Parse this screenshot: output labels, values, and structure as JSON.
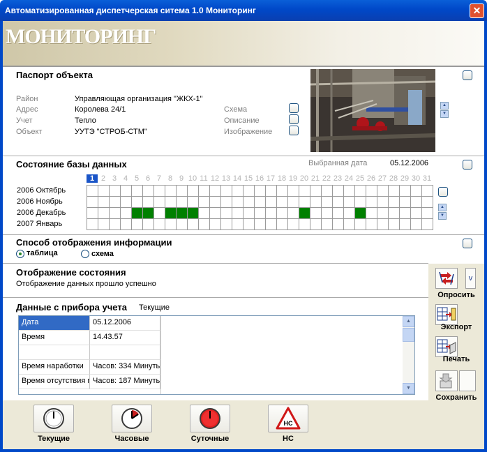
{
  "window": {
    "title": "Автоматизированная диспетчерская ситема 1.0 Мониторинг",
    "close_glyph": "✕"
  },
  "banner": {
    "text": "МОНИТОРИНГ"
  },
  "passport": {
    "title": "Паспорт объекта",
    "fields": [
      {
        "label": "Район",
        "value": "Управляющая организация \"ЖКХ-1\""
      },
      {
        "label": "Адрес",
        "value": "Королева 24/1"
      },
      {
        "label": "Учет",
        "value": "Тепло"
      },
      {
        "label": "Объект",
        "value": "УУТЭ \"СТРОБ-СТМ\""
      }
    ],
    "options": [
      {
        "label": "Схема",
        "checked": false
      },
      {
        "label": "Описание",
        "checked": false
      },
      {
        "label": "Изображение",
        "checked": false
      }
    ]
  },
  "database": {
    "title": "Состояние базы данных",
    "selected_date_label": "Выбранная дата",
    "selected_date": "05.12.2006",
    "selected_day": 1,
    "days": [
      "1",
      "2",
      "3",
      "4",
      "5",
      "6",
      "7",
      "8",
      "9",
      "10",
      "11",
      "12",
      "13",
      "14",
      "15",
      "16",
      "17",
      "18",
      "19",
      "20",
      "21",
      "22",
      "23",
      "24",
      "25",
      "26",
      "27",
      "28",
      "29",
      "30",
      "31"
    ],
    "months": [
      "2006 Октябрь",
      "2006 Ноябрь",
      "2006 Декабрь",
      "2007 Январь"
    ],
    "filled": [
      {
        "month": 2,
        "days": [
          5,
          6,
          8,
          9,
          10,
          20,
          25
        ]
      }
    ],
    "fill_color": "#008000"
  },
  "display_mode": {
    "title": "Способ отображения информации",
    "options": [
      {
        "label": "таблица",
        "selected": true
      },
      {
        "label": "схема",
        "selected": false
      }
    ]
  },
  "status": {
    "title": "Отображение состояния",
    "message": "Отображение данных прошло успешно"
  },
  "meter_data": {
    "title": "Данные с прибора учета",
    "mode": "Текущие",
    "rows": [
      {
        "name": "Дата",
        "value": "05.12.2006",
        "selected": true
      },
      {
        "name": "Время",
        "value": "14.43.57",
        "selected": false
      },
      {
        "name": "",
        "value": "",
        "selected": false
      },
      {
        "name": "Время наработки",
        "value": "Часов: 334  Минуть",
        "selected": false
      },
      {
        "name": "Время отсутствия п",
        "value": "Часов: 187  Минуть",
        "selected": false
      }
    ]
  },
  "toolbar": {
    "poll": "Опросить",
    "export": "Экспорт",
    "print": "Печать",
    "save": "Сохранить"
  },
  "bottom_buttons": [
    {
      "label": "Текущие",
      "icon": "clock-current-icon"
    },
    {
      "label": "Часовые",
      "icon": "clock-hourly-icon"
    },
    {
      "label": "Суточные",
      "icon": "clock-daily-icon"
    },
    {
      "label": "НС",
      "icon": "emergency-warning-icon",
      "icon_text": "НС"
    }
  ]
}
